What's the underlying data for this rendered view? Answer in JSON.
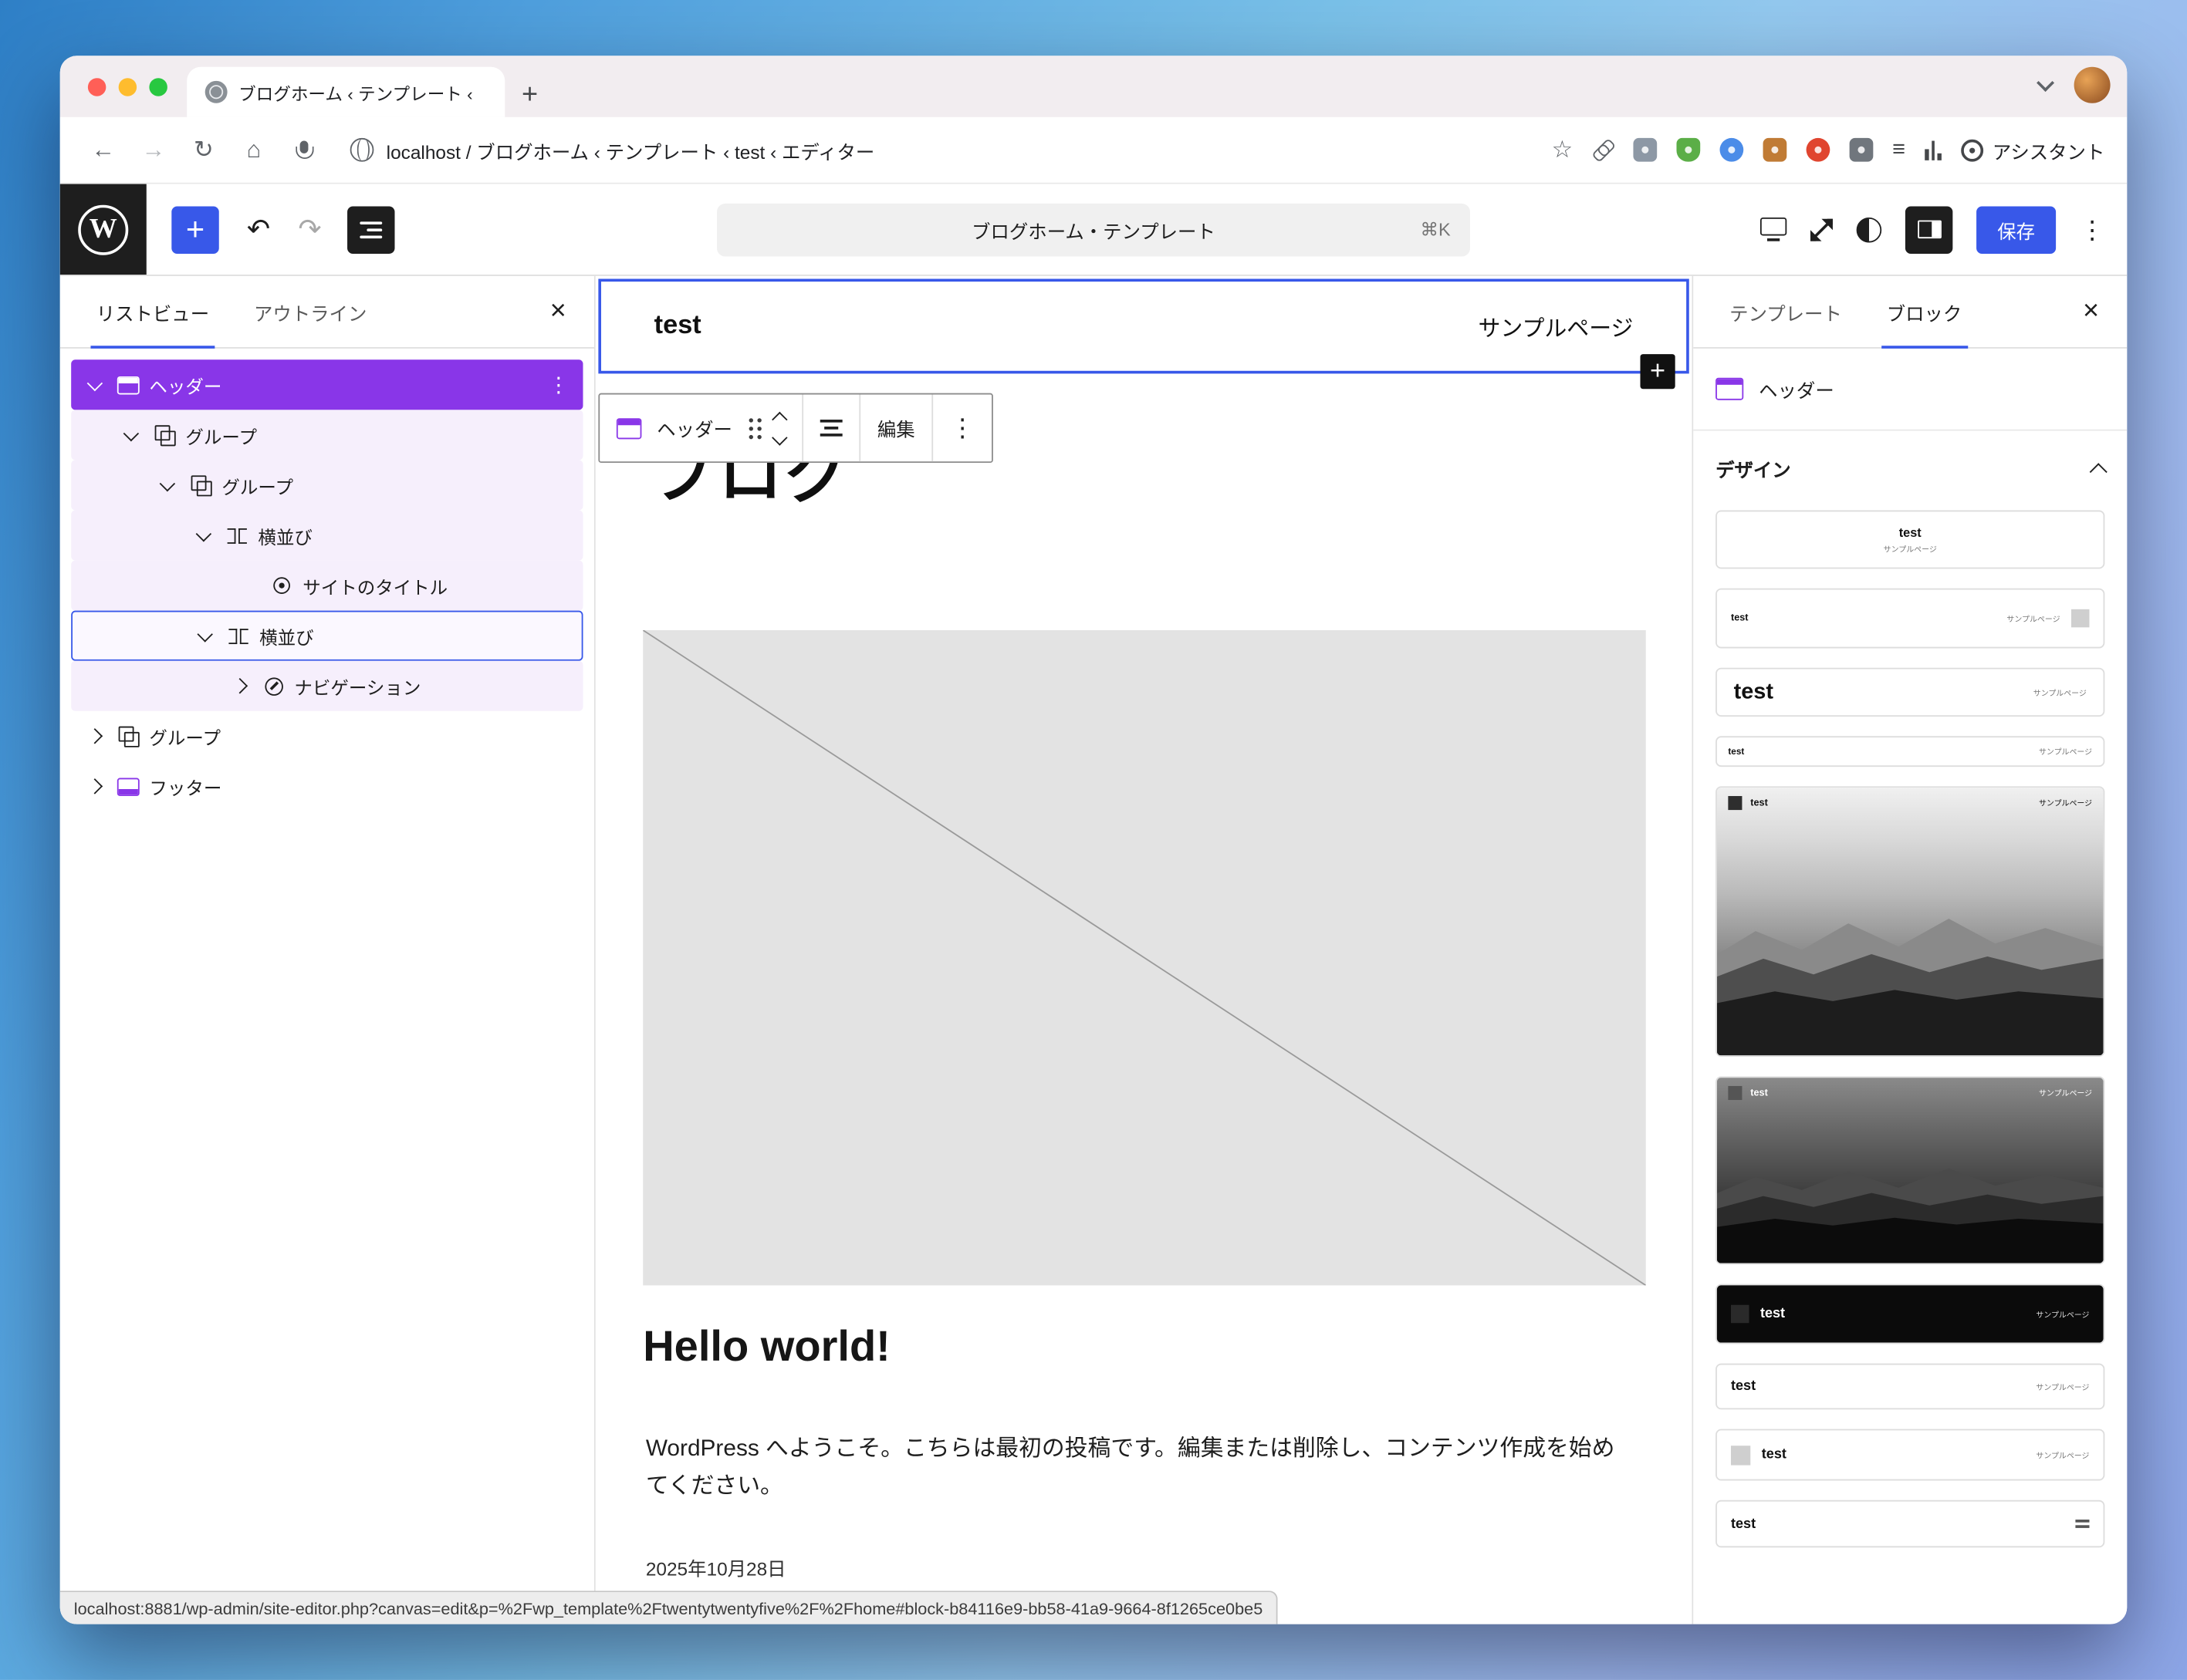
{
  "colors": {
    "accent": "#3858e9",
    "template_part_purple": "#8936e8",
    "selected_tint": "#f6effc"
  },
  "icons": {
    "plus": "+",
    "back": "←",
    "forward": "→",
    "reload": "↻",
    "home": "⌂",
    "star": "☆",
    "kebab": "⋮",
    "close": "×",
    "undo": "↶",
    "redo": "↷",
    "menu": "≡"
  },
  "window": {
    "tab_title": "ブログホーム ‹ テンプレート ‹",
    "address": "localhost / ブログホーム ‹ テンプレート ‹ test ‹ エディター",
    "assistant_label": "アシスタント",
    "status_url": "localhost:8881/wp-admin/site-editor.php?canvas=edit&p=%2Fwp_template%2Ftwentytwentyfive%2F%2Fhome#block-b84116e9-bb58-41a9-9664-8f1265ce0be5"
  },
  "editor_header": {
    "document_title": "ブログホーム・テンプレート",
    "shortcut": "⌘K",
    "save_label": "保存"
  },
  "list_view": {
    "tab_list": "リストビュー",
    "tab_outline": "アウトライン",
    "tree": [
      {
        "label": "ヘッダー"
      },
      {
        "label": "グループ"
      },
      {
        "label": "グループ"
      },
      {
        "label": "横並び"
      },
      {
        "label": "サイトのタイトル"
      },
      {
        "label": "横並び"
      },
      {
        "label": "ナビゲーション"
      },
      {
        "label": "グループ"
      },
      {
        "label": "フッター"
      }
    ]
  },
  "canvas": {
    "site_title": "test",
    "nav_item": "サンプルページ",
    "toolbar_block_label": "ヘッダー",
    "toolbar_edit": "編集",
    "page_heading": "ブログ",
    "post_title": "Hello world!",
    "post_body": "WordPress へようこそ。こちらは最初の投稿です。編集または削除し、コンテンツ作成を始めてください。",
    "post_date": "2025年10月28日"
  },
  "sidebar": {
    "tab_template": "テンプレート",
    "tab_block": "ブロック",
    "block_name": "ヘッダー",
    "design_section": "デザイン",
    "patterns": [
      {
        "title": "test",
        "subtitle": "サンプルページ"
      },
      {
        "title": "test",
        "nav": "サンプルページ"
      },
      {
        "title": "test",
        "nav": "サンプルページ"
      },
      {
        "title": "test",
        "nav": "サンプルページ"
      },
      {
        "title": "test",
        "nav": "サンプルページ"
      },
      {
        "title": "test",
        "nav": "サンプルページ"
      },
      {
        "title": "test",
        "nav": "サンプルページ"
      },
      {
        "title": "test",
        "nav": "サンプルページ"
      },
      {
        "title": "test",
        "nav": "サンプルページ"
      },
      {
        "title": "test"
      }
    ]
  }
}
